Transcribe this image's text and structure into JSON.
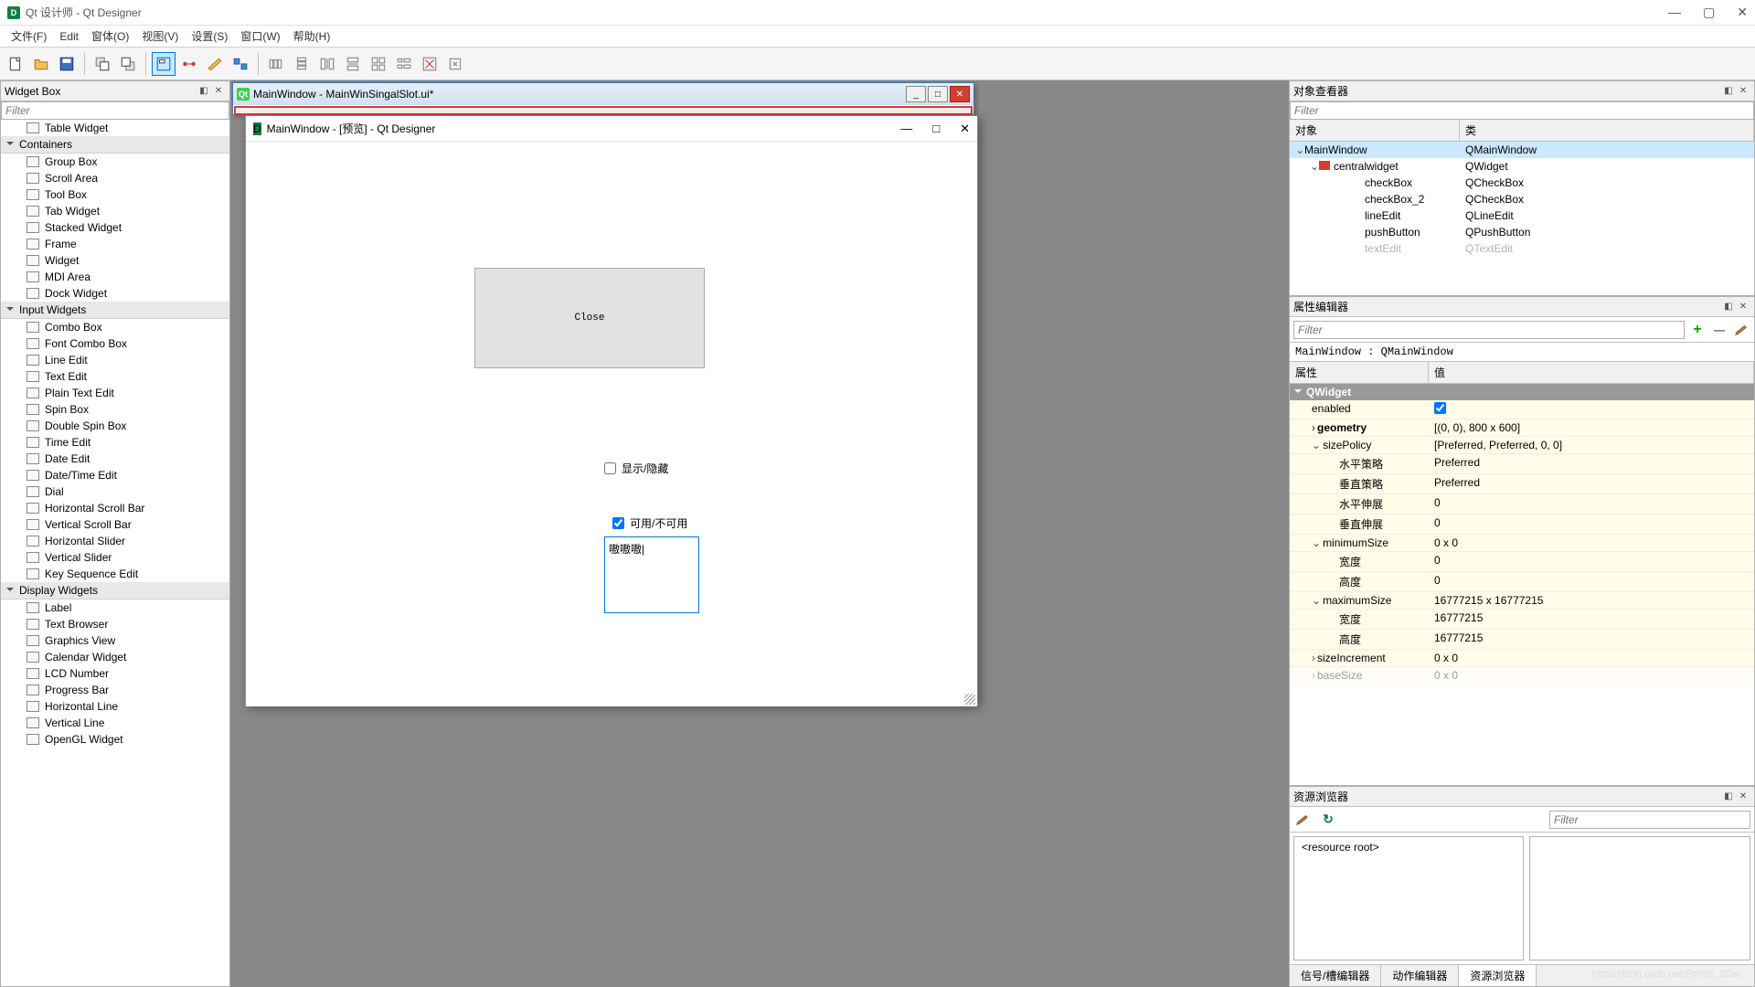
{
  "app": {
    "title": "Qt 设计师 - Qt Designer",
    "icon_letter": "D"
  },
  "menu": [
    "文件(F)",
    "Edit",
    "窗体(O)",
    "视图(V)",
    "设置(S)",
    "窗口(W)",
    "帮助(H)"
  ],
  "widget_box": {
    "title": "Widget Box",
    "filter_placeholder": "Filter",
    "top_item": "Table Widget",
    "groups": [
      {
        "name": "Containers",
        "items": [
          "Group Box",
          "Scroll Area",
          "Tool Box",
          "Tab Widget",
          "Stacked Widget",
          "Frame",
          "Widget",
          "MDI Area",
          "Dock Widget"
        ]
      },
      {
        "name": "Input Widgets",
        "items": [
          "Combo Box",
          "Font Combo Box",
          "Line Edit",
          "Text Edit",
          "Plain Text Edit",
          "Spin Box",
          "Double Spin Box",
          "Time Edit",
          "Date Edit",
          "Date/Time Edit",
          "Dial",
          "Horizontal Scroll Bar",
          "Vertical Scroll Bar",
          "Horizontal Slider",
          "Vertical Slider",
          "Key Sequence Edit"
        ]
      },
      {
        "name": "Display Widgets",
        "items": [
          "Label",
          "Text Browser",
          "Graphics View",
          "Calendar Widget",
          "LCD Number",
          "Progress Bar",
          "Horizontal Line",
          "Vertical Line",
          "OpenGL Widget"
        ]
      }
    ]
  },
  "designer_window": {
    "title": "MainWindow - MainWinSingalSlot.ui*"
  },
  "preview": {
    "title": "MainWindow - [预览] - Qt Designer",
    "close_button": "Close",
    "checkbox_show_hide": "显示/隐藏",
    "checkbox_enable": "可用/不可用",
    "textedit_value": "嗷嗷嗷|"
  },
  "object_inspector": {
    "title": "对象查看器",
    "filter_placeholder": "Filter",
    "headers": {
      "object": "对象",
      "class": "类"
    },
    "tree": [
      {
        "name": "MainWindow",
        "cls": "QMainWindow",
        "level": 0,
        "exp": "v",
        "selected": true
      },
      {
        "name": "centralwidget",
        "cls": "QWidget",
        "level": 1,
        "exp": "v",
        "icon": true
      },
      {
        "name": "checkBox",
        "cls": "QCheckBox",
        "level": 2
      },
      {
        "name": "checkBox_2",
        "cls": "QCheckBox",
        "level": 2
      },
      {
        "name": "lineEdit",
        "cls": "QLineEdit",
        "level": 2
      },
      {
        "name": "pushButton",
        "cls": "QPushButton",
        "level": 2
      },
      {
        "name": "textEdit",
        "cls": "QTextEdit",
        "level": 2,
        "partial": true
      }
    ]
  },
  "property_editor": {
    "title": "属性编辑器",
    "filter_placeholder": "Filter",
    "class_line": "MainWindow : QMainWindow",
    "headers": {
      "property": "属性",
      "value": "值"
    },
    "group": "QWidget",
    "rows": [
      {
        "name": "enabled",
        "value": "",
        "checkbox": true,
        "level": 1
      },
      {
        "name": "geometry",
        "value": "[(0, 0), 800 x 600]",
        "level": 1,
        "bold": true,
        "exp": ">"
      },
      {
        "name": "sizePolicy",
        "value": "[Preferred, Preferred, 0, 0]",
        "level": 1,
        "exp": "v"
      },
      {
        "name": "水平策略",
        "value": "Preferred",
        "level": 2
      },
      {
        "name": "垂直策略",
        "value": "Preferred",
        "level": 2
      },
      {
        "name": "水平伸展",
        "value": "0",
        "level": 2
      },
      {
        "name": "垂直伸展",
        "value": "0",
        "level": 2
      },
      {
        "name": "minimumSize",
        "value": "0 x 0",
        "level": 1,
        "exp": "v"
      },
      {
        "name": "宽度",
        "value": "0",
        "level": 2
      },
      {
        "name": "高度",
        "value": "0",
        "level": 2
      },
      {
        "name": "maximumSize",
        "value": "16777215 x 16777215",
        "level": 1,
        "exp": "v"
      },
      {
        "name": "宽度",
        "value": "16777215",
        "level": 2
      },
      {
        "name": "高度",
        "value": "16777215",
        "level": 2
      },
      {
        "name": "sizeIncrement",
        "value": "0 x 0",
        "level": 1,
        "exp": ">"
      },
      {
        "name": "baseSize",
        "value": "0 x 0",
        "level": 1,
        "exp": ">",
        "partial": true
      }
    ]
  },
  "resource_browser": {
    "title": "资源浏览器",
    "filter_placeholder": "Filter",
    "root": "<resource root>",
    "tabs": [
      "信号/槽编辑器",
      "动作编辑器",
      "资源浏览器"
    ],
    "active_tab": 2
  },
  "watermark": "https://blog.csdn.net/Forest_2Cat"
}
